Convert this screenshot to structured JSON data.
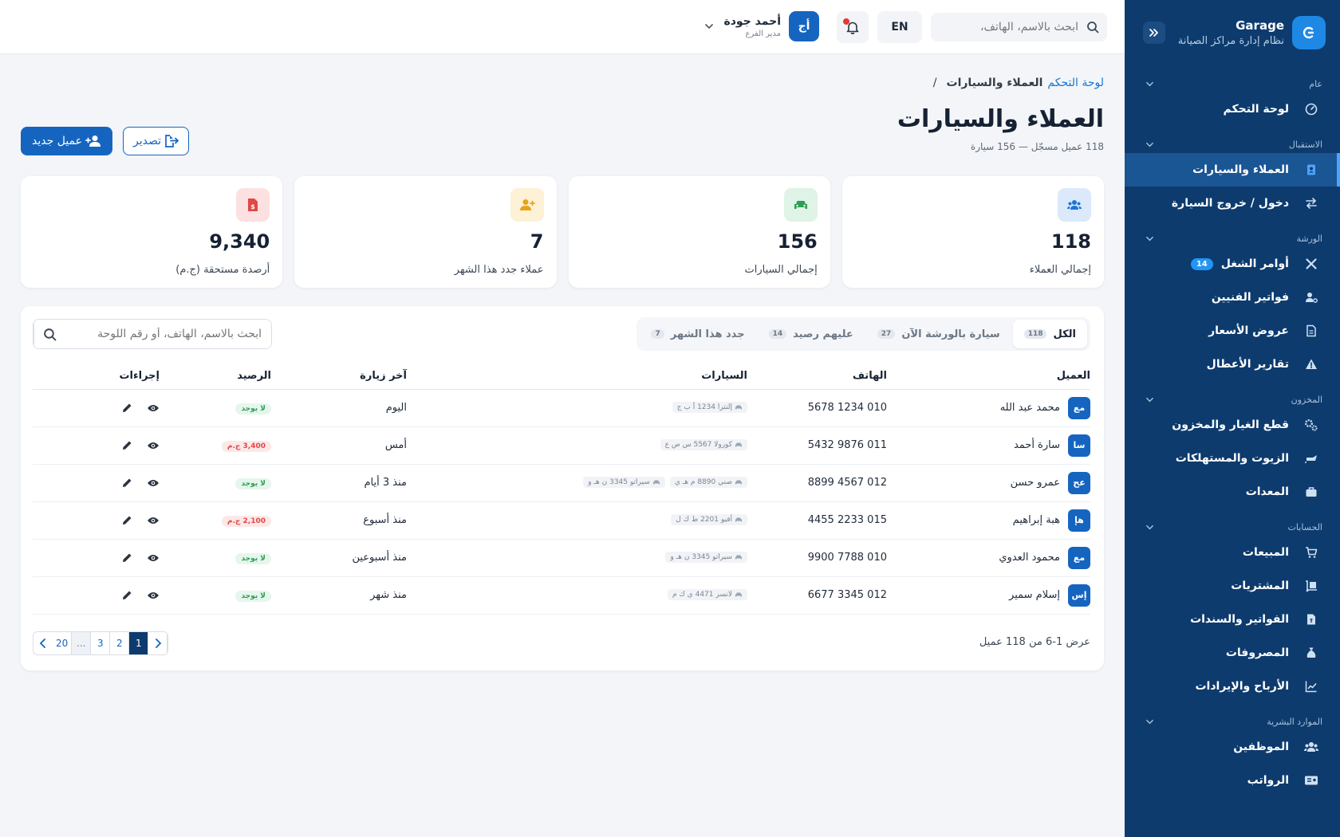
{
  "brand": {
    "name": "Garage",
    "subtitle": "نظام إدارة مراكز الصيانة"
  },
  "sidebar": {
    "sections": [
      {
        "title": "عام",
        "items": [
          {
            "label": "لوحة التحكم",
            "icon": "gauge-icon"
          }
        ]
      },
      {
        "title": "الاستقبال",
        "items": [
          {
            "label": "العملاء والسيارات",
            "icon": "address-book-icon",
            "active": true
          },
          {
            "label": "دخول / خروج السيارة",
            "icon": "arrows-exchange-icon"
          }
        ]
      },
      {
        "title": "الورشة",
        "items": [
          {
            "label": "أوامر الشغل",
            "icon": "tools-icon",
            "badge": "14"
          },
          {
            "label": "فواتير الفنيين",
            "icon": "user-gear-icon"
          },
          {
            "label": "عروض الأسعار",
            "icon": "document-icon"
          },
          {
            "label": "تقارير الأعطال",
            "icon": "warning-icon"
          }
        ]
      },
      {
        "title": "المخزون",
        "items": [
          {
            "label": "قطع الغيار والمخزون",
            "icon": "cogs-icon"
          },
          {
            "label": "الزيوت والمستهلكات",
            "icon": "oil-can-icon"
          },
          {
            "label": "المعدات",
            "icon": "toolbox-icon"
          }
        ]
      },
      {
        "title": "الحسابات",
        "items": [
          {
            "label": "المبيعات",
            "icon": "cart-icon"
          },
          {
            "label": "المشتريات",
            "icon": "dolly-icon"
          },
          {
            "label": "الفواتير والسندات",
            "icon": "invoice-icon"
          },
          {
            "label": "المصروفات",
            "icon": "money-bag-icon"
          },
          {
            "label": "الأرباح والإيرادات",
            "icon": "chart-line-icon"
          }
        ]
      },
      {
        "title": "الموارد البشرية",
        "items": [
          {
            "label": "الموظفين",
            "icon": "users-icon"
          },
          {
            "label": "الرواتب",
            "icon": "id-card-icon"
          }
        ]
      }
    ]
  },
  "topbar": {
    "search_placeholder": "ابحث بالاسم، الهاتف، ",
    "lang": "EN",
    "user": {
      "initials": "أج",
      "name": "أحمد جودة",
      "role": "مدير الفرع"
    }
  },
  "page": {
    "breadcrumb": {
      "home": "لوحة التحكم",
      "current": "العملاء والسيارات",
      "sep": "/"
    },
    "title": "العملاء والسيارات",
    "subtitle": "118 عميل مسجّل — 156 سيارة",
    "new_button": "عميل جديد",
    "export_button": "تصدير"
  },
  "stats": [
    {
      "value": "118",
      "label": "إجمالي العملاء",
      "icon": "users-icon",
      "bg": "#dbe9fb",
      "fg": "#1e74d8"
    },
    {
      "value": "156",
      "label": "إجمالي السيارات",
      "icon": "car-icon",
      "bg": "#dff3e6",
      "fg": "#2e9d55"
    },
    {
      "value": "7",
      "label": "عملاء جدد هذا الشهر",
      "icon": "user-plus-icon",
      "bg": "#fdf1d6",
      "fg": "#e8a319"
    },
    {
      "value": "9,340",
      "label": "أرصدة مستحقة (ج.م)",
      "icon": "invoice-dollar-icon",
      "bg": "#fde1e1",
      "fg": "#e04848"
    }
  ],
  "tabs": [
    {
      "label": "الكل",
      "count": "118",
      "active": true
    },
    {
      "label": "سيارة بالورشة الآن",
      "count": "27"
    },
    {
      "label": "عليهم رصيد",
      "count": "14"
    },
    {
      "label": "جدد هذا الشهر",
      "count": "7"
    }
  ],
  "table_search_placeholder": "ابحث بالاسم، الهاتف، أو رقم اللوحة",
  "table": {
    "headers": {
      "client": "العميل",
      "phone": "الهاتف",
      "cars": "السيارات",
      "last_visit": "آخر زيارة",
      "balance": "الرصيد",
      "actions": "إجراءات"
    },
    "rows": [
      {
        "initials": "مع",
        "name": "محمد عبد الله",
        "phone": "010 1234 5678",
        "cars": [
          "إلنترا 1234 أ ب ج"
        ],
        "last_visit": "اليوم",
        "balance": "لا يوجد",
        "due": false
      },
      {
        "initials": "سا",
        "name": "سارة أحمد",
        "phone": "011 9876 5432",
        "cars": [
          "كورولا 5567 س ص ع"
        ],
        "last_visit": "أمس",
        "balance": "3,400 ج.م",
        "due": true
      },
      {
        "initials": "عح",
        "name": "عمرو حسن",
        "phone": "012 4567 8899",
        "cars": [
          "صني 8890 م هـ ي",
          "سيراتو 3345 ن هـ و"
        ],
        "last_visit": "منذ 3 أيام",
        "balance": "لا يوجد",
        "due": false
      },
      {
        "initials": "هإ",
        "name": "هبة إبراهيم",
        "phone": "015 2233 4455",
        "cars": [
          "أفيو 2201 ط ك ل"
        ],
        "last_visit": "منذ أسبوع",
        "balance": "2,100 ج.م",
        "due": true
      },
      {
        "initials": "مع",
        "name": "محمود العدوي",
        "phone": "010 7788 9900",
        "cars": [
          "سيراتو 3345 ن هـ و"
        ],
        "last_visit": "منذ أسبوعين",
        "balance": "لا يوجد",
        "due": false
      },
      {
        "initials": "إس",
        "name": "إسلام سمير",
        "phone": "012 3345 6677",
        "cars": [
          "لانسر 4471 ي ك م"
        ],
        "last_visit": "منذ شهر",
        "balance": "لا يوجد",
        "due": false
      }
    ]
  },
  "pagination": {
    "info": "عرض 1-6 من 118 عميل",
    "pages": [
      "1",
      "2",
      "3",
      "...",
      "20"
    ],
    "current": "1"
  }
}
